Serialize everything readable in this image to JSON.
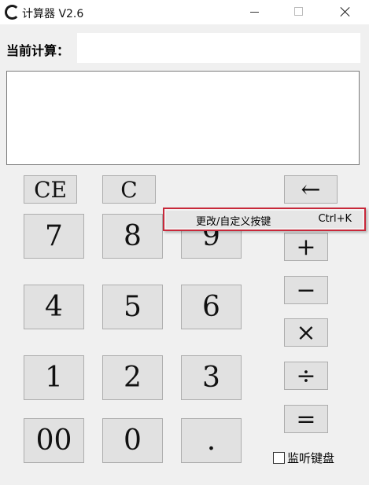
{
  "window": {
    "title": "计算器 V2.6"
  },
  "current": {
    "label": "当前计算：",
    "value": ""
  },
  "history": {
    "content": ""
  },
  "buttons": {
    "ce": "CE",
    "c": "C",
    "backspace": "←",
    "seven": "7",
    "eight": "8",
    "nine": "9",
    "four": "4",
    "five": "5",
    "six": "6",
    "one": "1",
    "two": "2",
    "three": "3",
    "double_zero": "00",
    "zero": "0",
    "dot": ".",
    "plus": "+",
    "minus": "−",
    "multiply": "×",
    "divide": "÷",
    "equals": "="
  },
  "monitor_keyboard": {
    "label": "监听键盘",
    "checked": false
  },
  "context_menu": {
    "item_label": "更改/自定义按键",
    "shortcut": "Ctrl+K"
  },
  "icons": [
    "app-icon",
    "minimize-icon",
    "maximize-icon",
    "close-icon",
    "checkbox-icon"
  ]
}
